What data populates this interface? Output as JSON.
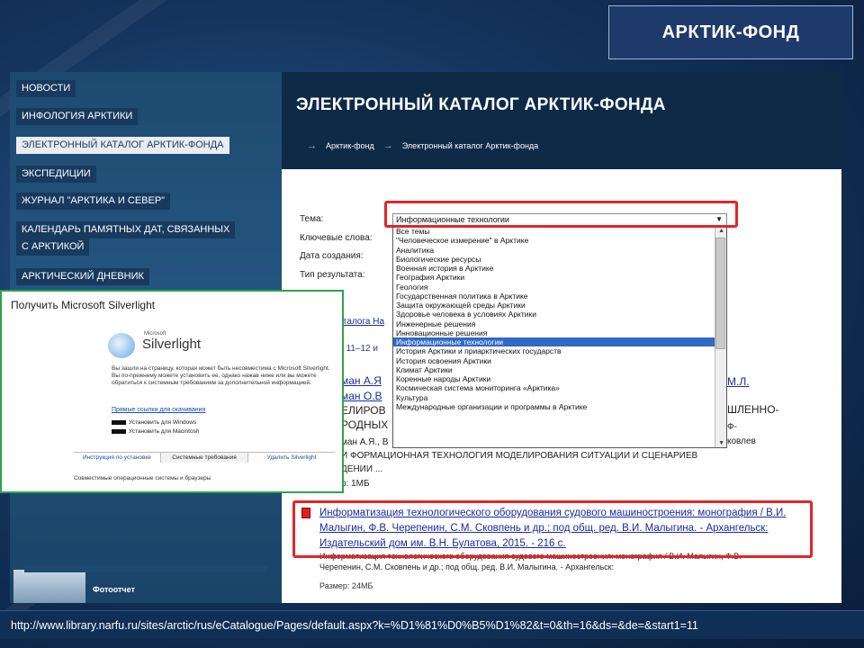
{
  "slide": {
    "title": "АРКТИК-ФОНД",
    "url": "http://www.library.narfu.ru/sites/arctic/rus/eCatalogue/Pages/default.aspx?k=%D1%81%D0%B5%D1%82&t=0&th=16&ds=&de=&start1=11"
  },
  "site": {
    "nav": [
      "НОВОСТИ",
      "ИНФОЛОГИЯ АРКТИКИ",
      "ЭЛЕКТРОННЫЙ КАТАЛОГ АРКТИК-ФОНДА",
      "ЭКСПЕДИЦИИ",
      "ЖУРНАЛ \"АРКТИКА И СЕВЕР\"",
      "КАЛЕНДАРЬ ПАМЯТНЫХ ДАТ, СВЯЗАННЫХ",
      "С АРКТИКОЙ",
      "АРКТИЧЕСКИЙ ДНЕВНИК"
    ],
    "photo_report": "Фотоотчет",
    "page_title": "ЭЛЕКТРОННЫЙ КАТАЛОГ АРКТИК-ФОНДА",
    "breadcrumb": [
      "Арктик-фонд",
      "Электронный каталог Арктик-фонда"
    ],
    "breadcrumb_arrow": "→",
    "form": {
      "theme_label": "Тема:",
      "keywords_label": "Ключевые слова:",
      "date_label": "Дата создания:",
      "type_label": "Тип результата:",
      "theme_selected": "Информационные технологии"
    },
    "dropdown_options": [
      "Все темы",
      "\"Человеческое измерение\" в Арктике",
      "Аналитика",
      "Биологические ресурсы",
      "Военная история в Арктике",
      "География Арктики",
      "Геология",
      "Государственная политика в Арктике",
      "Защита окружающей среды Арктики",
      "Здоровье человека в условиях Арктики",
      "Инженерные решения",
      "Инновационные решения",
      "Информационные технологии",
      "История Арктики и приарктических государств",
      "История освоения Арктики",
      "Климат Арктики",
      "Коренные народы Арктики",
      "Космическая система мониторинга «Арктика»",
      "Культура",
      "Международные организации и программы в Арктике"
    ],
    "background_fragments": {
      "catalog_prefix": "каталога На",
      "results": ": 11–12 и",
      "author1": "ман А.Я",
      "author2": "ман О.В",
      "model": "ЕЛИРОВ",
      "peoples": "РОДНЫХ",
      "author3": "ман А.Я., В",
      "right1": "М.Л.",
      "right2": "ШЛЕННО-",
      "right3": "Ф-",
      "right4": "ковлев",
      "desc_line": "И ФОРМАЦИОННАЯ ТЕХНОЛОГИЯ МОДЕЛИРОВАНИЯ СИТУАЦИИ И СЦЕНАРИЕВ",
      "desc_line2": "ДЕНИИ ...",
      "size_frag": "р: 1МБ"
    },
    "result": {
      "link": "Информатизация технологического оборудования судового машиностроения: монография / В.И. Малыгин, Ф.В. Черепенин, С.М. Сковпень и др.; под общ. ред. В.И. Малыгина. - Архангельск: Издательский дом им. В.Н. Булатова, 2015. - 216 с.",
      "description": "Информатизация технологического оборудования судового машиностроения: монография / В.И. Малыгин, Ф.В. Черепенин, С.М. Сковпень и др.; под общ. ред. В.И. Малыгина. - Архангельск:",
      "size": "Размер: 24МБ"
    },
    "silverlight": {
      "title": "Получить Microsoft Silverlight",
      "ms_small": "Microsoft",
      "name": "Silverlight",
      "text": "Вы зашли на страницу, которая может быть несовместима с Microsoft Silverlight. Вы по-прежнему можете установить ее, однако нажав ниже или вы можете обратиться к системным требованиям за дополнительной информацией.",
      "requirements_link": "Прямые ссылки для скачивания",
      "dl_windows": "Установить для Windows",
      "dl_mac": "Установить для Macintosh",
      "tabs": [
        "Инструкция по установке",
        "Системные требования",
        "Удалить Silverlight"
      ],
      "footer": "Совместимые операционные системы и браузеры"
    }
  }
}
